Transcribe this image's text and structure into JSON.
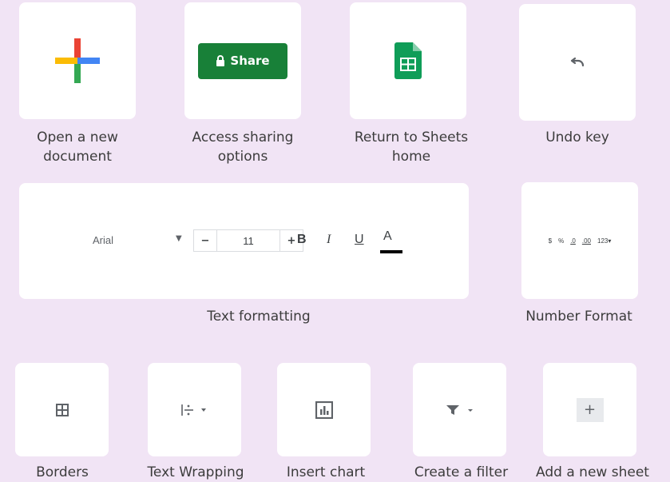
{
  "items": {
    "new_doc": {
      "label": "Open a new\ndocument",
      "icon": "google-plus-icon"
    },
    "share": {
      "label": "Access sharing\noptions",
      "button_text": "Share",
      "icon": "lock-icon",
      "color": "#188038"
    },
    "sheets_home": {
      "label": "Return to Sheets\nhome",
      "icon": "sheets-logo-icon",
      "color": "#0f9d58"
    },
    "undo": {
      "label": "Undo key",
      "icon": "undo-icon"
    },
    "text_formatting": {
      "label": "Text formatting",
      "font": "Arial",
      "font_size": "11",
      "bold": "B",
      "italic": "I",
      "underline": "U",
      "text_color": "A"
    },
    "number_format": {
      "label": "Number Format",
      "currency": "$",
      "percent": "%",
      "decrease_decimal": ".0",
      "increase_decimal": ".00",
      "more_formats": "123"
    },
    "borders": {
      "label": "Borders",
      "icon": "borders-icon"
    },
    "text_wrapping": {
      "label": "Text Wrapping",
      "icon": "text-wrap-icon"
    },
    "insert_chart": {
      "label": "Insert chart",
      "icon": "chart-icon"
    },
    "create_filter": {
      "label": "Create a filter",
      "icon": "filter-icon"
    },
    "add_sheet": {
      "label": "Add a new sheet",
      "icon": "plus-icon"
    }
  },
  "colors": {
    "background": "#f1e4f5",
    "card": "#ffffff",
    "google_blue": "#4285f4",
    "google_red": "#ea4335",
    "google_yellow": "#fbbc05",
    "google_green": "#34a853"
  }
}
